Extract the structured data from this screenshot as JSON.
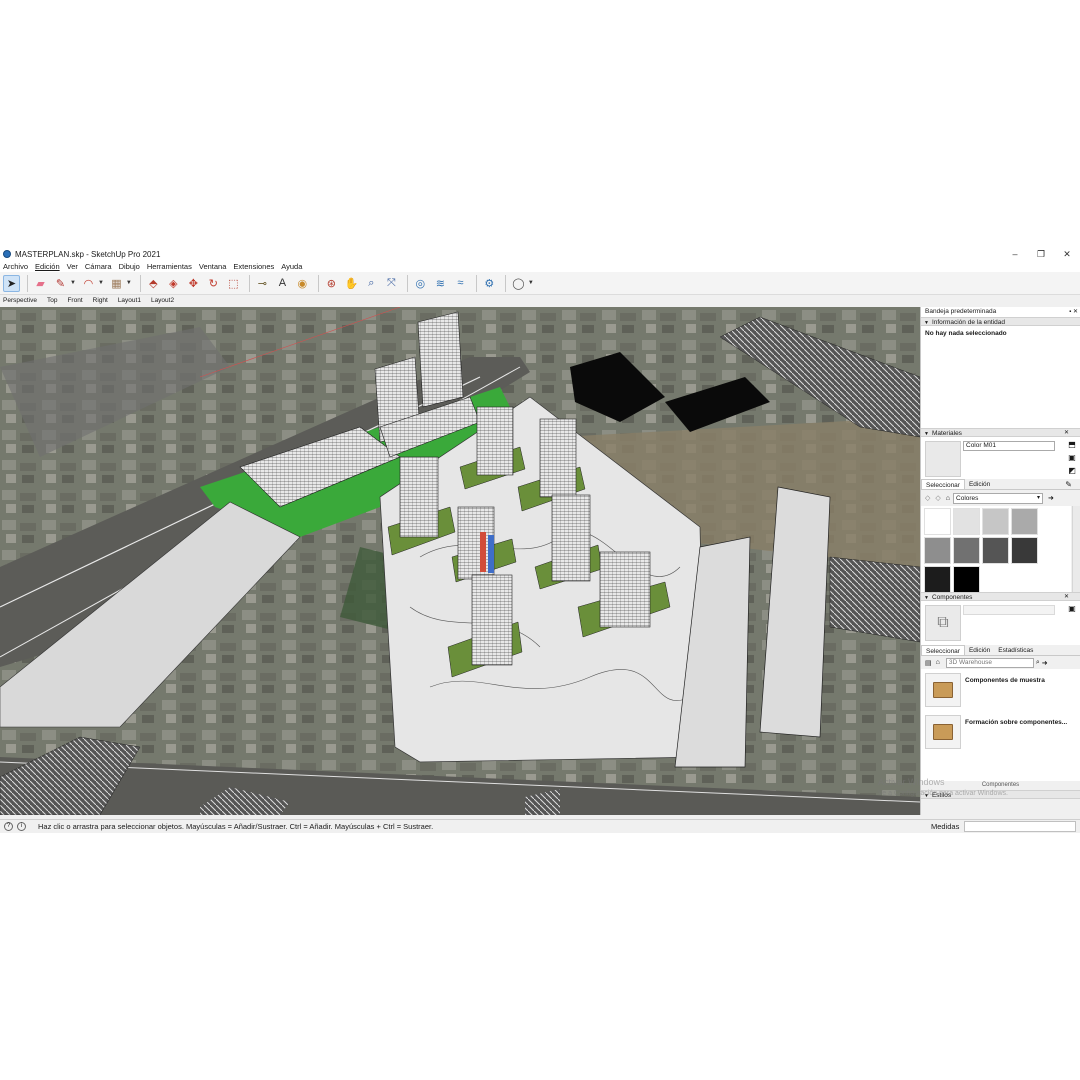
{
  "window": {
    "title": "MASTERPLAN.skp - SketchUp Pro 2021",
    "controls": [
      "–",
      "❐",
      "✕"
    ]
  },
  "menu": [
    "Archivo",
    "Edición",
    "Ver",
    "Cámara",
    "Dibujo",
    "Herramientas",
    "Ventana",
    "Extensiones",
    "Ayuda"
  ],
  "toolbar": {
    "tools": [
      {
        "icon": "select-arrow-icon",
        "glyph": "➤"
      },
      {
        "icon": "eraser-icon",
        "glyph": "▰"
      },
      {
        "icon": "pencil-icon",
        "glyph": "✎"
      },
      {
        "icon": "arc-icon",
        "glyph": "◠"
      },
      {
        "icon": "rectangle-icon",
        "glyph": "▦"
      },
      {
        "icon": "push-pull-icon",
        "glyph": "⬘"
      },
      {
        "icon": "offset-icon",
        "glyph": "◈"
      },
      {
        "icon": "move-icon",
        "glyph": "✥"
      },
      {
        "icon": "rotate-icon",
        "glyph": "↻"
      },
      {
        "icon": "scale-icon",
        "glyph": "⬚"
      },
      {
        "icon": "tape-measure-icon",
        "glyph": "⊸"
      },
      {
        "icon": "text-icon",
        "glyph": "A"
      },
      {
        "icon": "paint-bucket-icon",
        "glyph": "◉"
      },
      {
        "icon": "orbit-icon",
        "glyph": "⊛"
      },
      {
        "icon": "pan-icon",
        "glyph": "✋"
      },
      {
        "icon": "zoom-icon",
        "glyph": "⌕"
      },
      {
        "icon": "zoom-extents-icon",
        "glyph": "⤧"
      },
      {
        "icon": "3d-warehouse-icon",
        "glyph": "◎"
      },
      {
        "icon": "extension-warehouse-icon",
        "glyph": "≋"
      },
      {
        "icon": "send-to-layout-icon",
        "glyph": "≈"
      },
      {
        "icon": "extension-manager-icon",
        "glyph": "⚙"
      },
      {
        "icon": "account-icon",
        "glyph": "◯"
      }
    ]
  },
  "scenes": [
    "Perspective",
    "Top",
    "Front",
    "Right",
    "Layout1",
    "Layout2"
  ],
  "tray": {
    "title": "Bandeja predeterminada",
    "pin": "▪ ✕",
    "entity_info": {
      "header": "Información de la entidad",
      "message": "No hay nada seleccionado"
    },
    "materials": {
      "header": "Materiales",
      "name": "Color M01",
      "tabs": [
        "Seleccionar",
        "Edición"
      ],
      "library": "Colores",
      "swatch_colors": [
        "#ffffff",
        "#e2e2e2",
        "#c6c6c6",
        "#aaaaaa",
        "#8e8e8e",
        "#717171",
        "#555555",
        "#393939",
        "#1c1c1c",
        "#000000"
      ]
    },
    "components": {
      "header": "Componentes",
      "tabs": [
        "Seleccionar",
        "Edición",
        "Estadísticas"
      ],
      "search_placeholder": "3D Warehouse",
      "items": [
        "Componentes de muestra",
        "Formación sobre componentes..."
      ],
      "footer": "Componentes"
    },
    "styles": {
      "header": "Estilos"
    }
  },
  "watermark": {
    "line1": "Activar Windows",
    "line2": "Ve a Configuración para activar Windows."
  },
  "status": {
    "hint": "Haz clic o arrastra para seleccionar objetos. Mayúsculas = Añadir/Sustraer. Ctrl = Añadir. Mayúsculas + Ctrl = Sustraer.",
    "measure_label": "Medidas",
    "measure_value": ""
  },
  "colors": {
    "accent_green": "#3aa93a",
    "selected_tool": "#cfe3f7"
  }
}
